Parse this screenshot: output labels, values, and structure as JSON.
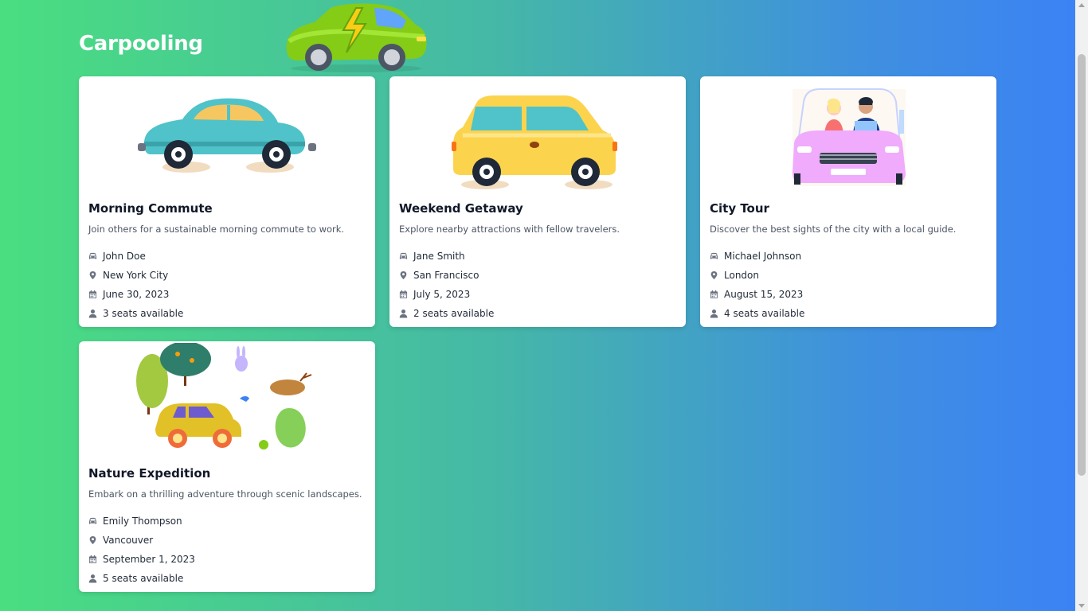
{
  "page": {
    "title": "Carpooling"
  },
  "colors": {
    "gradient_start": "#4ade80",
    "gradient_end": "#3b82f6",
    "card_bg": "#ffffff",
    "icon": "#6b7280"
  },
  "icons": {
    "driver": "car-icon",
    "location": "map-pin-icon",
    "date": "calendar-icon",
    "seats": "user-icon"
  },
  "rides": [
    {
      "title": "Morning Commute",
      "description": "Join others for a sustainable morning commute to work.",
      "driver": "John Doe",
      "location": "New York City",
      "date": "June 30, 2023",
      "seats": "3 seats available"
    },
    {
      "title": "Weekend Getaway",
      "description": "Explore nearby attractions with fellow travelers.",
      "driver": "Jane Smith",
      "location": "San Francisco",
      "date": "July 5, 2023",
      "seats": "2 seats available"
    },
    {
      "title": "City Tour",
      "description": "Discover the best sights of the city with a local guide.",
      "driver": "Michael Johnson",
      "location": "London",
      "date": "August 15, 2023",
      "seats": "4 seats available"
    },
    {
      "title": "Nature Expedition",
      "description": "Embark on a thrilling adventure through scenic landscapes.",
      "driver": "Emily Thompson",
      "location": "Vancouver",
      "date": "September 1, 2023",
      "seats": "5 seats available"
    }
  ]
}
